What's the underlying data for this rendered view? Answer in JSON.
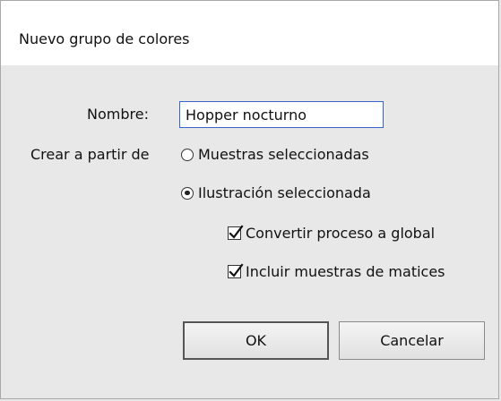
{
  "dialog": {
    "title": "Nuevo grupo de colores"
  },
  "form": {
    "name_label": "Nombre:",
    "name_value": "Hopper nocturno",
    "create_from_label": "Crear a partir de",
    "options": {
      "selected_swatches": {
        "label": "Muestras seleccionadas",
        "checked": false
      },
      "selected_artwork": {
        "label": "Ilustración seleccionada",
        "checked": true
      }
    },
    "checkboxes": {
      "convert_process_global": {
        "label": "Convertir proceso a global",
        "checked": true
      },
      "include_tints": {
        "label": "Incluir muestras de matices",
        "checked": true
      }
    }
  },
  "buttons": {
    "ok_label": "OK",
    "cancel_label": "Cancelar"
  },
  "colors": {
    "input_border": "#3464c8",
    "dialog_bg": "#e8e8e8",
    "titlebar_bg": "#ffffff"
  }
}
